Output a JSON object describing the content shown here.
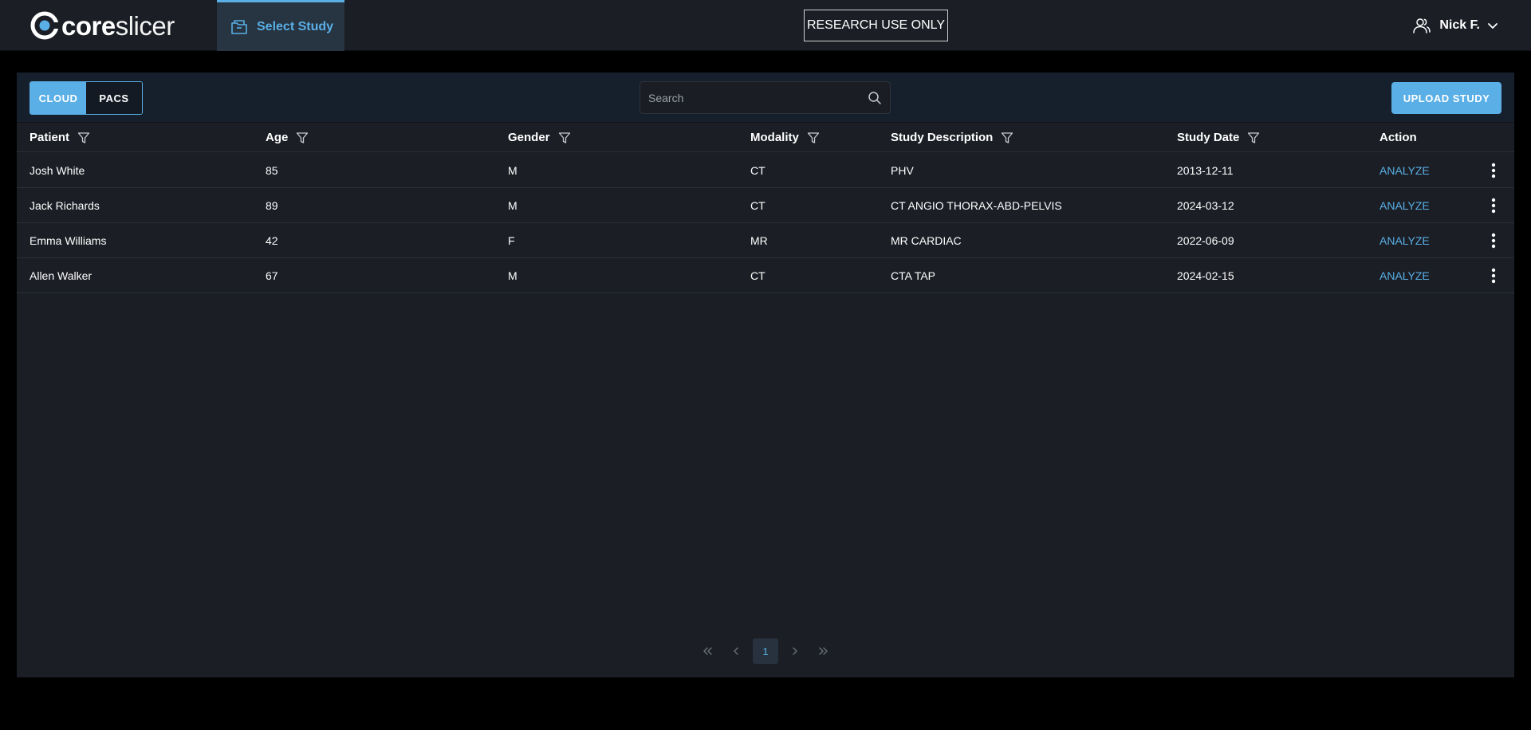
{
  "header": {
    "logo_bold": "core",
    "logo_light": "slicer",
    "nav_tab_label": "Select Study",
    "research_badge": "RESEARCH USE ONLY",
    "user_name": "Nick F."
  },
  "toolbar": {
    "segments": [
      {
        "label": "CLOUD",
        "active": true
      },
      {
        "label": "PACS",
        "active": false
      }
    ],
    "search_placeholder": "Search",
    "upload_label": "UPLOAD STUDY"
  },
  "table": {
    "columns": [
      {
        "label": "Patient",
        "filterable": true
      },
      {
        "label": "Age",
        "filterable": true
      },
      {
        "label": "Gender",
        "filterable": true
      },
      {
        "label": "Modality",
        "filterable": true
      },
      {
        "label": "Study Description",
        "filterable": true
      },
      {
        "label": "Study Date",
        "filterable": true
      },
      {
        "label": "Action",
        "filterable": false
      }
    ],
    "rows": [
      {
        "patient": "Josh White",
        "age": "85",
        "gender": "M",
        "modality": "CT",
        "description": "PHV",
        "date": "2013-12-11",
        "action": "ANALYZE"
      },
      {
        "patient": "Jack Richards",
        "age": "89",
        "gender": "M",
        "modality": "CT",
        "description": "CT ANGIO THORAX-ABD-PELVIS",
        "date": "2024-03-12",
        "action": "ANALYZE"
      },
      {
        "patient": "Emma Williams",
        "age": "42",
        "gender": "F",
        "modality": "MR",
        "description": "MR CARDIAC",
        "date": "2022-06-09",
        "action": "ANALYZE"
      },
      {
        "patient": "Allen Walker",
        "age": "67",
        "gender": "M",
        "modality": "CT",
        "description": "CTA TAP",
        "date": "2024-02-15",
        "action": "ANALYZE"
      }
    ]
  },
  "pagination": {
    "current_page": "1"
  },
  "colors": {
    "accent": "#5aafe6",
    "background": "#000000",
    "panel": "#1b1e25",
    "toolbar": "#16202d"
  }
}
